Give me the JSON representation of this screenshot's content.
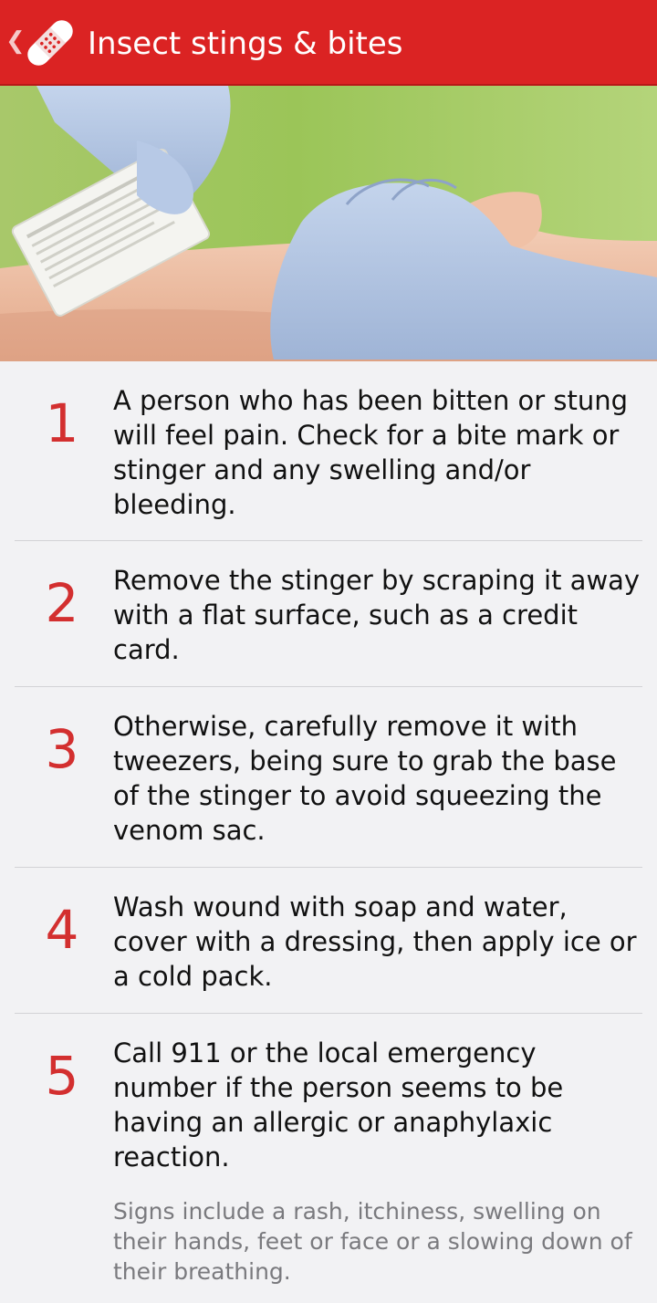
{
  "app_bar": {
    "back_icon": "chevron-left-icon",
    "app_icon": "bandage-icon",
    "title": "Insect stings & bites",
    "background_color": "#db2323"
  },
  "hero_image": {
    "subject": "gloved hands scraping a stinger from an arm with a credit card"
  },
  "steps": [
    {
      "number": "1",
      "text": "A person who has been bitten or stung will feel pain. Check for a bite mark or stinger and any swelling and/or bleeding."
    },
    {
      "number": "2",
      "text": "Remove the stinger by scraping it away with a flat surface, such as a credit card."
    },
    {
      "number": "3",
      "text": "Otherwise, carefully remove it with tweezers, being sure to grab the base of the stinger to avoid squeezing the venom sac."
    },
    {
      "number": "4",
      "text": "Wash wound with soap and water, cover with a dressing, then apply ice or a cold pack."
    },
    {
      "number": "5",
      "text": "Call 911 or the local emergency number if the person seems to be having an allergic or anaphylaxic reaction.",
      "note": "Signs include a rash, itchiness, swelling on their hands, feet or face or a slowing down of their breathing."
    }
  ],
  "colors": {
    "accent": "#d32f2f",
    "background": "#f2f2f4",
    "body_text": "#111111",
    "note_text": "#7a7a7e"
  }
}
